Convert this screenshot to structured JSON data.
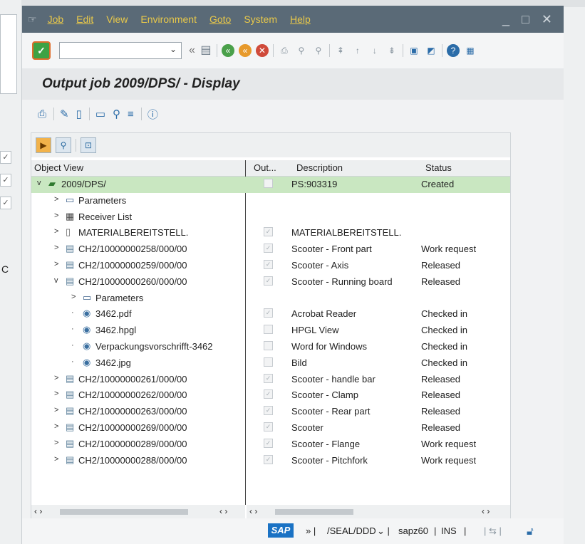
{
  "menu": {
    "items": [
      "Job",
      "Edit",
      "View",
      "Environment",
      "Goto",
      "System",
      "Help"
    ],
    "window_controls": "_ □ ✕"
  },
  "toolbar": {
    "command_field_value": ""
  },
  "title": "Output job 2009/DPS/ - Display",
  "columns": {
    "object_view": "Object View",
    "out": "Out...",
    "description": "Description",
    "status": "Status"
  },
  "rows": [
    {
      "name": "2009/DPS/",
      "desc": "PS:903319",
      "status": "Created",
      "level": 0,
      "expander": "v",
      "icon": "job-icon",
      "out": false,
      "selected": true
    },
    {
      "name": "Parameters",
      "desc": "",
      "status": "",
      "level": 1,
      "expander": ">",
      "icon": "parameters-icon",
      "out": false
    },
    {
      "name": "Receiver List",
      "desc": "",
      "status": "",
      "level": 1,
      "expander": ">",
      "icon": "receiver-list-icon",
      "out": false
    },
    {
      "name": "MATERIALBEREITSTELL.",
      "desc": "MATERIALBEREITSTELL.",
      "status": "",
      "level": 1,
      "expander": ">",
      "icon": "document-icon",
      "out": true
    },
    {
      "name": "CH2/10000000258/000/00",
      "desc": "Scooter - Front part",
      "status": "Work request",
      "level": 1,
      "expander": ">",
      "icon": "document-info-icon",
      "out": true
    },
    {
      "name": "CH2/10000000259/000/00",
      "desc": "Scooter - Axis",
      "status": "Released",
      "level": 1,
      "expander": ">",
      "icon": "document-info-icon",
      "out": true
    },
    {
      "name": "CH2/10000000260/000/00",
      "desc": "Scooter - Running board",
      "status": "Released",
      "level": 1,
      "expander": "v",
      "icon": "document-info-icon",
      "out": true
    },
    {
      "name": "Parameters",
      "desc": "",
      "status": "",
      "level": 2,
      "expander": ">",
      "icon": "parameters-icon",
      "out": false
    },
    {
      "name": "3462.pdf",
      "desc": "Acrobat Reader",
      "status": "Checked in",
      "level": 2,
      "expander": "·",
      "icon": "file-original-icon",
      "out": true
    },
    {
      "name": "3462.hpgl",
      "desc": "HPGL View",
      "status": "Checked in",
      "level": 2,
      "expander": "·",
      "icon": "file-original-icon",
      "out": false
    },
    {
      "name": "Verpackungsvorschrifft-3462",
      "desc": "Word for Windows",
      "status": "Checked in",
      "level": 2,
      "expander": "·",
      "icon": "file-original-icon",
      "out": false
    },
    {
      "name": "3462.jpg",
      "desc": "Bild",
      "status": "Checked in",
      "level": 2,
      "expander": "·",
      "icon": "file-original-icon",
      "out": false
    },
    {
      "name": "CH2/10000000261/000/00",
      "desc": "Scooter - handle bar",
      "status": "Released",
      "level": 1,
      "expander": ">",
      "icon": "document-info-icon",
      "out": true
    },
    {
      "name": "CH2/10000000262/000/00",
      "desc": "Scooter - Clamp",
      "status": "Released",
      "level": 1,
      "expander": ">",
      "icon": "document-info-icon",
      "out": true
    },
    {
      "name": "CH2/10000000263/000/00",
      "desc": "Scooter - Rear part",
      "status": "Released",
      "level": 1,
      "expander": ">",
      "icon": "document-info-icon",
      "out": true
    },
    {
      "name": "CH2/10000000269/000/00",
      "desc": "Scooter",
      "status": "Released",
      "level": 1,
      "expander": ">",
      "icon": "document-info-icon",
      "out": true
    },
    {
      "name": "CH2/10000000289/000/00",
      "desc": "Scooter - Flange",
      "status": "Work request",
      "level": 1,
      "expander": ">",
      "icon": "document-info-icon",
      "out": true
    },
    {
      "name": "CH2/10000000288/000/00",
      "desc": "Scooter - Pitchfork",
      "status": "Work request",
      "level": 1,
      "expander": ">",
      "icon": "document-info-icon",
      "out": true
    }
  ],
  "statusbar": {
    "sap_logo": "SAP",
    "program": "/SEAL/DDD",
    "server": "sapz60",
    "mode": "INS"
  },
  "colors": {
    "menubar_bg": "#5a6a77",
    "menu_text": "#e8c84a",
    "selected_row": "#c9e7c1",
    "sap_blue": "#1a72c4"
  }
}
